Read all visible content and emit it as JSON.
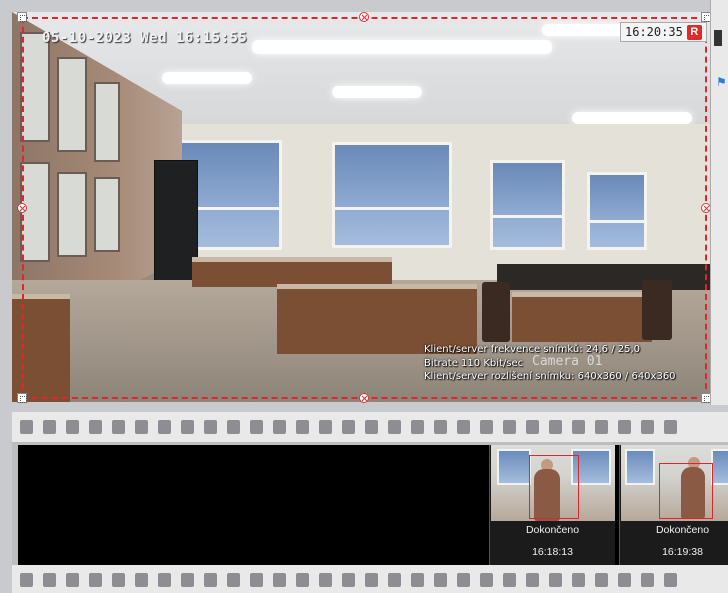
{
  "camera": {
    "date_overlay": "05-10-2023 Wed 16:15:55",
    "camera_label": "Camera 01",
    "stats": {
      "frame_rate": "Klient/server frekvence snímků: 24,6 / 25,0",
      "bitrate": "Bitrate 110 Kbit/sec",
      "resolution": "Klient/server rozlišení snímku: 640x360 / 640x360"
    }
  },
  "clock": {
    "time": "16:20:35",
    "record_badge": "R"
  },
  "timeline": {
    "thumbnails": [
      {
        "status": "Dokončeno",
        "time": "16:18:13"
      },
      {
        "status": "Dokončeno",
        "time": "16:19:38"
      }
    ]
  },
  "colors": {
    "selection": "#e0262b",
    "record": "#e02a2a",
    "film_background": "#000000"
  }
}
